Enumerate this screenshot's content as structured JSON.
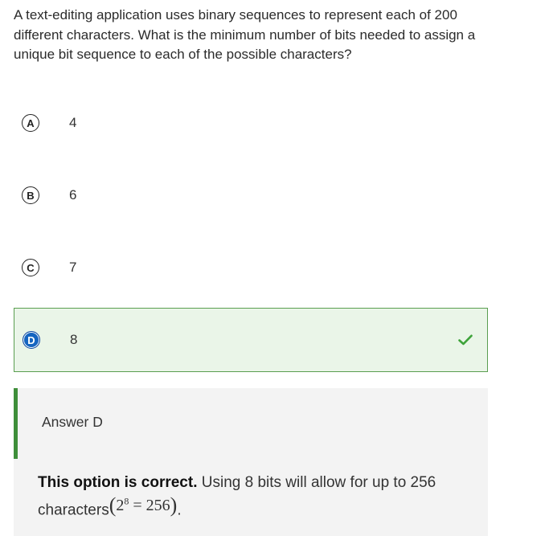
{
  "question": {
    "text": "A text-editing application uses binary sequences to represent each of 200 different characters. What is the minimum number of bits needed to assign a unique bit sequence to each of the possible characters?"
  },
  "options": [
    {
      "letter": "A",
      "value": "4"
    },
    {
      "letter": "B",
      "value": "6"
    },
    {
      "letter": "C",
      "value": "7"
    },
    {
      "letter": "D",
      "value": "8"
    }
  ],
  "selected_option": "D",
  "check_icon": "checkmark-icon",
  "colors": {
    "correct_bg": "#eaf5e8",
    "correct_border": "#5a9e50",
    "badge_selected": "#1565c0",
    "check": "#3ea33a",
    "explain_bg": "#f3f3f3",
    "explain_bar": "#3e8e3a"
  },
  "explanation": {
    "answer_label": "Answer D",
    "lead": "This option is correct.",
    "text_1": "Using 8 bits will allow for up to 256",
    "text_2": "characters",
    "math_base": "2",
    "math_exp": "8",
    "math_rest": "= 256",
    "math_open": "(",
    "math_close": ")",
    "end": "."
  }
}
